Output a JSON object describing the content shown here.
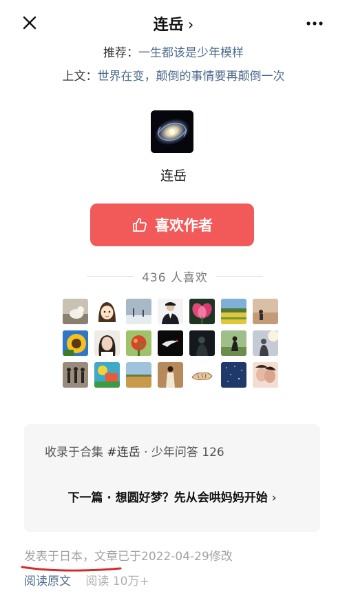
{
  "header": {
    "title": "连岳",
    "title_chevron": "›"
  },
  "recommend": {
    "prefix": "推荐：",
    "link": "一生都该是少年模样"
  },
  "previous": {
    "prefix": "上文：",
    "link": "世界在变，颠倒的事情要再颠倒一次"
  },
  "author": {
    "name": "连岳",
    "avatar_icon": "galaxy-avatar"
  },
  "like_button": {
    "label": "喜欢作者",
    "icon": "thumbs-up-icon",
    "color": "#f25a5a"
  },
  "likes": {
    "count_text": "436 人喜欢"
  },
  "liker_avatars": [
    {
      "name": "cat-photo"
    },
    {
      "name": "cartoon-girl"
    },
    {
      "name": "snow-landscape"
    },
    {
      "name": "man-in-suit"
    },
    {
      "name": "pink-lotus"
    },
    {
      "name": "yellow-field"
    },
    {
      "name": "person-on-sand"
    },
    {
      "name": "sunflower"
    },
    {
      "name": "woman-portrait"
    },
    {
      "name": "green-plant"
    },
    {
      "name": "dark-bird"
    },
    {
      "name": "dark-figure"
    },
    {
      "name": "girl-in-field"
    },
    {
      "name": "person-in-light"
    },
    {
      "name": "group-silhouette"
    },
    {
      "name": "colorful-painting"
    },
    {
      "name": "savanna"
    },
    {
      "name": "girl-standing"
    },
    {
      "name": "tiger-sketch"
    },
    {
      "name": "night-sky"
    },
    {
      "name": "couple-kiss"
    }
  ],
  "collection_card": {
    "collect_prefix": "收录于合集",
    "collect_tag": "#连岳",
    "collect_suffix": "· 少年问答 126",
    "next_text": "下一篇 · 想圆好梦？先从会哄妈妈开始",
    "next_chevron": "›"
  },
  "footer": {
    "published_text": "发表于日本，文章已于2022-04-29修改",
    "read_original": "阅读原文",
    "views_text": "阅读 10万+"
  },
  "colors": {
    "link": "#4d6b8c",
    "accent_red": "#f25a5a",
    "annotation_red": "#d42a2a"
  }
}
